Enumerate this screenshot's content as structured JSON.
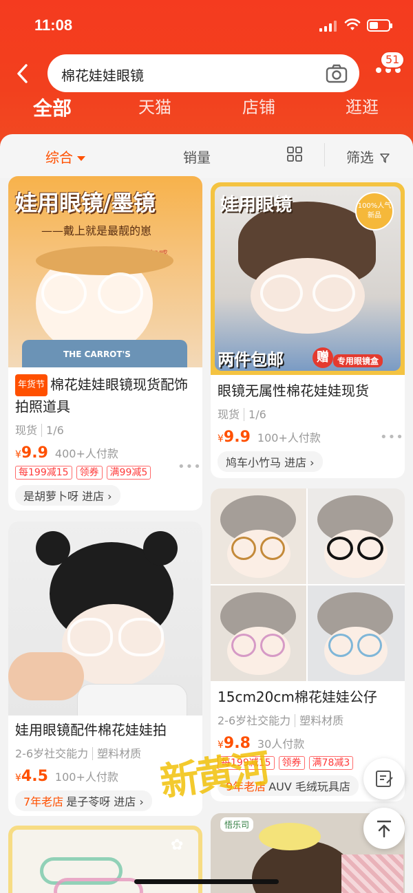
{
  "status": {
    "time": "11:08"
  },
  "search": {
    "query": "棉花娃娃眼镜",
    "message_count": "51"
  },
  "tabs": [
    "全部",
    "天猫",
    "店铺",
    "逛逛"
  ],
  "sort": {
    "comprehensive": "综合",
    "sales": "销量",
    "filter": "筛选"
  },
  "products": [
    {
      "image_text": "娃用眼镜/墨镜",
      "image_subtext": "——戴上就是最靓的崽",
      "image_corner": "少年感",
      "image_footer": "THE CARROT'S",
      "tag": "年货节",
      "title": "棉花娃娃眼镜现货配饰拍照道具",
      "attrs": [
        "现货",
        "1/6"
      ],
      "price": "9.9",
      "sold": "400+人付款",
      "coupons": [
        "每199减15",
        "领券",
        "满99减5"
      ],
      "shop": "是胡萝卜呀 进店"
    },
    {
      "image_text": "娃用眼镜",
      "image_badge": "100%人气新品",
      "image_footer": "两件包邮",
      "image_gift": "赠",
      "image_gift_text": "专用眼镜盒",
      "title": "眼镜无属性棉花娃娃现货",
      "attrs": [
        "现货",
        "1/6"
      ],
      "price": "9.9",
      "sold": "100+人付款",
      "shop": "鸠车小竹马 进店"
    },
    {
      "title": "娃用眼镜配件棉花娃娃拍",
      "attrs": [
        "2-6岁社交能力",
        "塑料材质"
      ],
      "price": "4.5",
      "sold": "100+人付款",
      "shop_age": "7年老店",
      "shop": "是子苓呀 进店"
    },
    {
      "title": "15cm20cm棉花娃娃公仔",
      "attrs": [
        "2-6岁社交能力",
        "塑料材质"
      ],
      "price": "9.8",
      "sold": "30人付款",
      "coupons": [
        "每199减15",
        "领券",
        "满78减3"
      ],
      "shop_age": "9年老店",
      "shop": "AUV 毛绒玩具店"
    },
    {
      "image_badge": "悟乐司"
    }
  ],
  "watermark": "新黄河",
  "colors": {
    "brand": "#f2401e",
    "price": "#ff5000"
  }
}
